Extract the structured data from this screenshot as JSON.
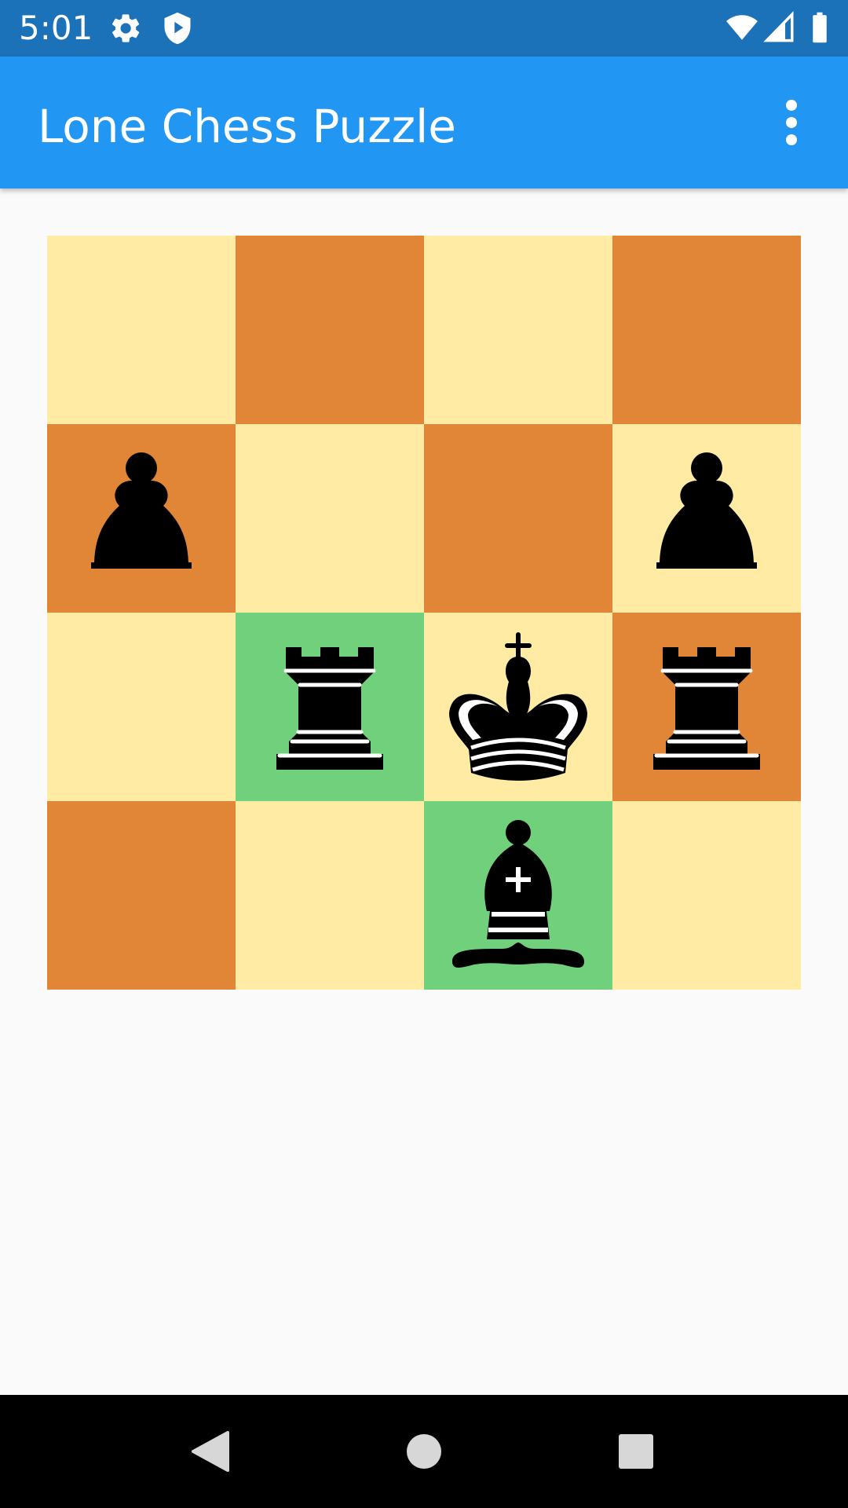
{
  "status_bar": {
    "time": "5:01",
    "left_icons": [
      "settings-icon",
      "shield-play-icon"
    ],
    "right_icons": [
      "wifi-icon",
      "cell-signal-icon",
      "battery-icon"
    ]
  },
  "app_bar": {
    "title": "Lone Chess Puzzle",
    "overflow_icon": "more-vert-icon"
  },
  "colors": {
    "status_bar": "#1C72B8",
    "app_bar": "#2196F3",
    "light_square": "#FFEBA3",
    "dark_square": "#E08636",
    "highlight_square": "#70D07C",
    "piece": "#000000",
    "background": "#FAFAFA"
  },
  "board": {
    "size": 4,
    "rows": [
      [
        {
          "color": "light",
          "piece": null
        },
        {
          "color": "dark",
          "piece": null
        },
        {
          "color": "light",
          "piece": null
        },
        {
          "color": "dark",
          "piece": null
        }
      ],
      [
        {
          "color": "dark",
          "piece": "pawn"
        },
        {
          "color": "light",
          "piece": null
        },
        {
          "color": "dark",
          "piece": null
        },
        {
          "color": "light",
          "piece": "pawn"
        }
      ],
      [
        {
          "color": "light",
          "piece": null
        },
        {
          "color": "highlight",
          "piece": "rook"
        },
        {
          "color": "light",
          "piece": "king"
        },
        {
          "color": "dark",
          "piece": "rook"
        }
      ],
      [
        {
          "color": "dark",
          "piece": null
        },
        {
          "color": "light",
          "piece": null
        },
        {
          "color": "highlight",
          "piece": "bishop"
        },
        {
          "color": "light",
          "piece": null
        }
      ]
    ]
  },
  "nav_bar": {
    "buttons": [
      "back-icon",
      "home-icon",
      "recents-icon"
    ]
  }
}
